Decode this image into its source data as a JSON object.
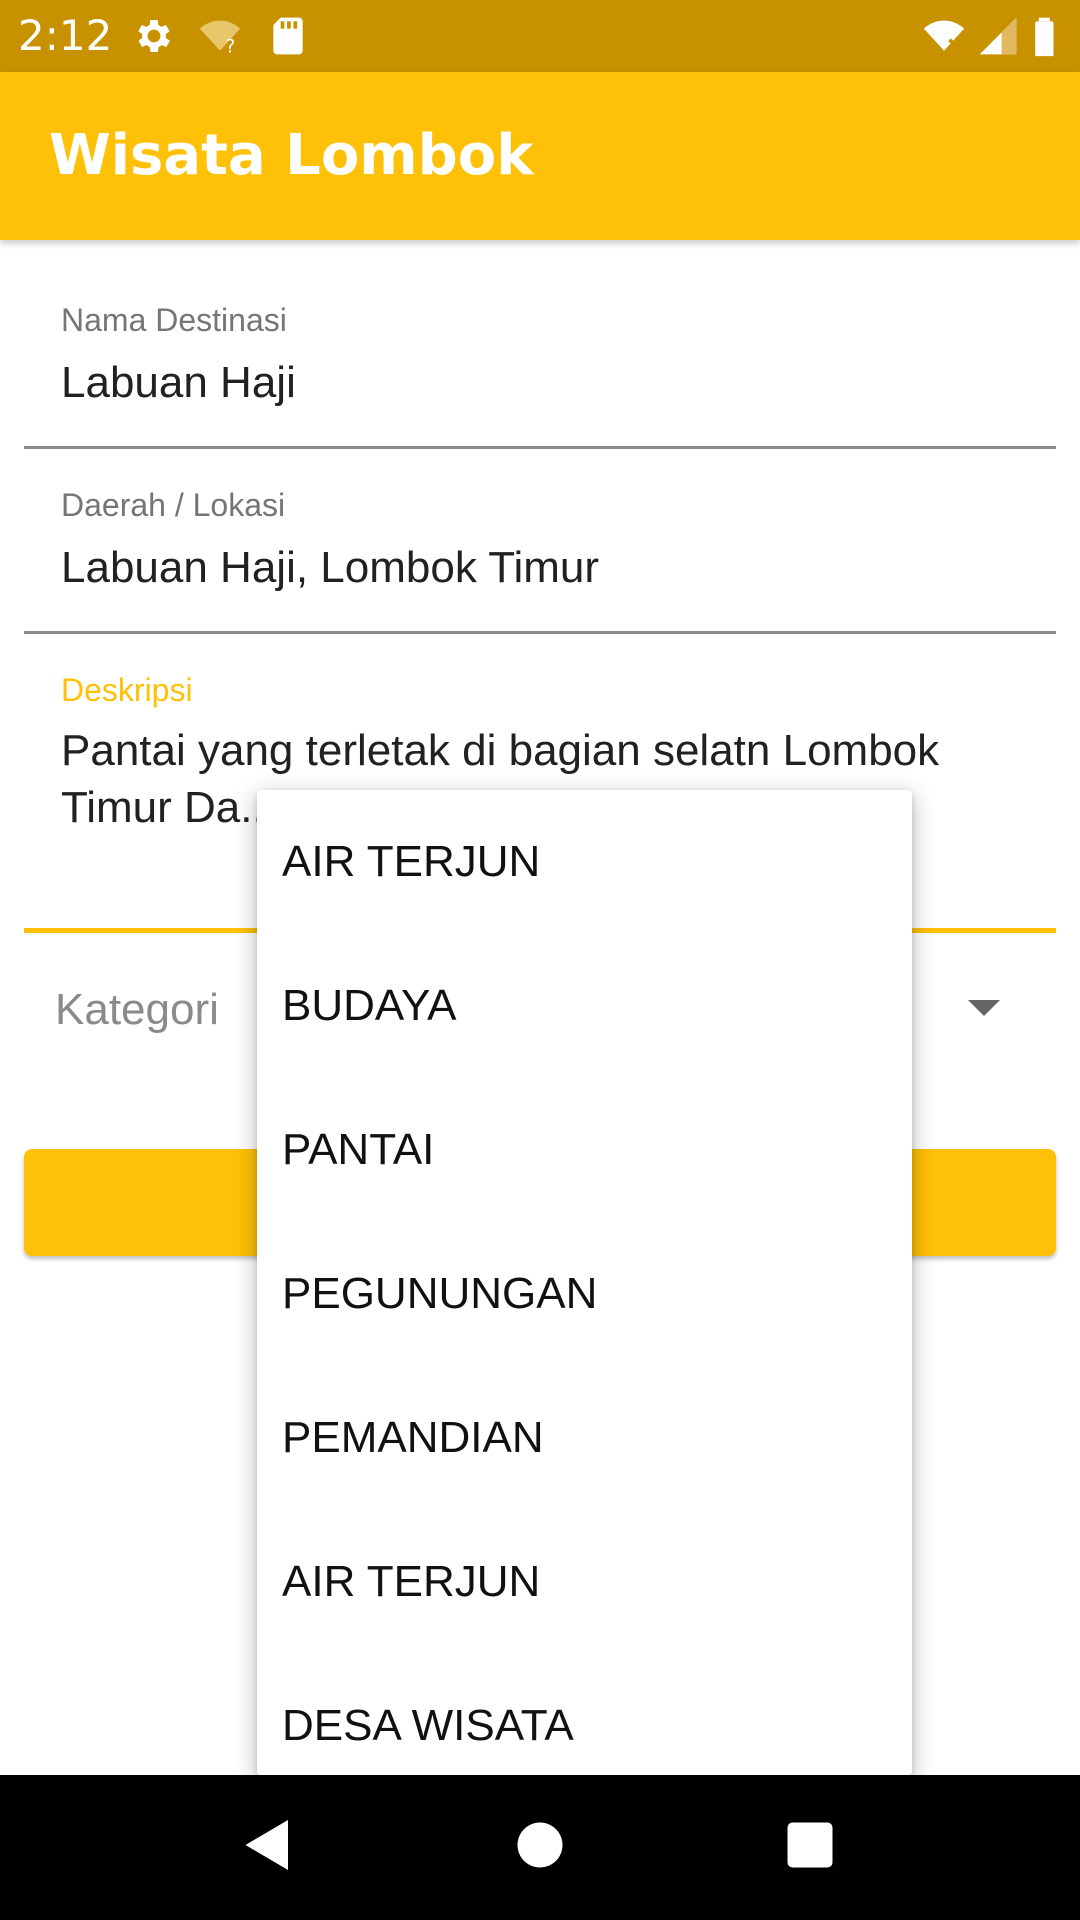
{
  "status_bar": {
    "time": "2:12",
    "icons": [
      "settings-icon",
      "wifi-question-icon",
      "sd-card-icon",
      "wifi-x-icon",
      "signal-icon",
      "battery-icon"
    ]
  },
  "app_bar": {
    "title": "Wisata Lombok"
  },
  "form": {
    "nama": {
      "label": "Nama Destinasi",
      "value": "Labuan Haji"
    },
    "daerah": {
      "label": "Daerah / Lokasi",
      "value": "Labuan Haji, Lombok Timur"
    },
    "deskripsi": {
      "label": "Deskripsi",
      "value": "Pantai yang terletak di bagian selatn Lombok Timur Da... dengan m..."
    },
    "kategori": {
      "label": "Kategori"
    },
    "save_label": ""
  },
  "dropdown": {
    "options": [
      "AIR TERJUN",
      "BUDAYA",
      "PANTAI",
      "PEGUNUNGAN",
      "PEMANDIAN",
      "AIR TERJUN",
      "DESA WISATA"
    ]
  },
  "nav_bar": {
    "icons": [
      "back-icon",
      "home-icon",
      "recents-icon"
    ]
  },
  "colors": {
    "primary": "#ffc107",
    "primary_dark": "#c79100",
    "text": "#212121",
    "hint": "#757575"
  }
}
